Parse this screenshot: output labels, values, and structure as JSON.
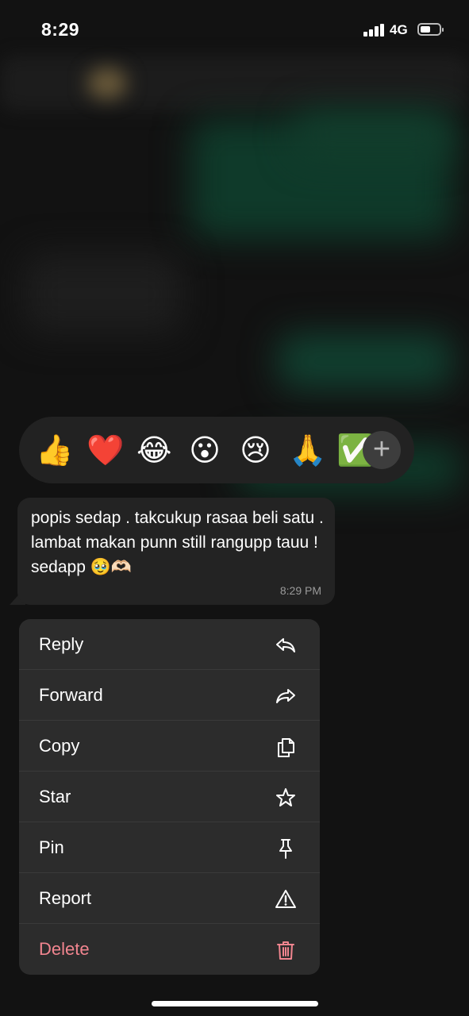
{
  "status_bar": {
    "time": "8:29",
    "network": "4G"
  },
  "reactions": {
    "emojis": [
      "👍",
      "❤️",
      "😂",
      "😮",
      "😢",
      "🙏",
      "✅"
    ],
    "more_label": "+"
  },
  "message": {
    "text": "popis sedap . takcukup rasaa beli satu . lambat makan punn still rangupp tauu ! sedapp 🥹🫶🏻",
    "time": "8:29 PM"
  },
  "menu": {
    "reply": "Reply",
    "forward": "Forward",
    "copy": "Copy",
    "star": "Star",
    "pin": "Pin",
    "report": "Report",
    "delete": "Delete"
  },
  "colors": {
    "menu_background": "#2c2c2c",
    "delete_text": "#f1858f",
    "bubble": "#232323"
  }
}
